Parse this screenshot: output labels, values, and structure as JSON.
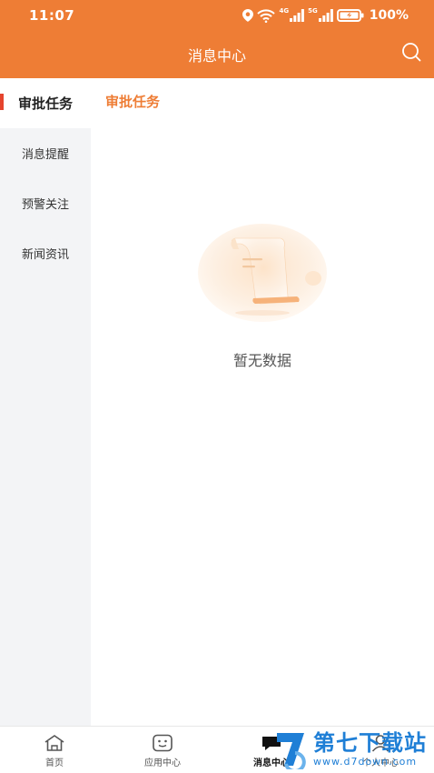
{
  "status_bar": {
    "time": "11:07",
    "net1": "4G",
    "net2": "5G",
    "battery": "100%"
  },
  "header": {
    "title": "消息中心",
    "search_icon": "search-icon"
  },
  "sidebar": {
    "items": [
      {
        "label": "审批任务",
        "active": true
      },
      {
        "label": "消息提醒",
        "active": false
      },
      {
        "label": "预警关注",
        "active": false
      },
      {
        "label": "新闻资讯",
        "active": false
      }
    ]
  },
  "content": {
    "section_title": "审批任务",
    "empty_text": "暂无数据"
  },
  "tabbar": {
    "tabs": [
      {
        "label": "首页",
        "icon": "home-icon"
      },
      {
        "label": "应用中心",
        "icon": "apps-icon"
      },
      {
        "label": "消息中心",
        "icon": "message-icon",
        "active": true
      },
      {
        "label": "个人中心",
        "icon": "user-icon"
      }
    ]
  },
  "watermark": {
    "main": "第七下载站",
    "sub": "www.d7down.com"
  },
  "colors": {
    "accent": "#ee7d35",
    "indicator": "#e5442e",
    "watermark": "#1f7fd6"
  }
}
